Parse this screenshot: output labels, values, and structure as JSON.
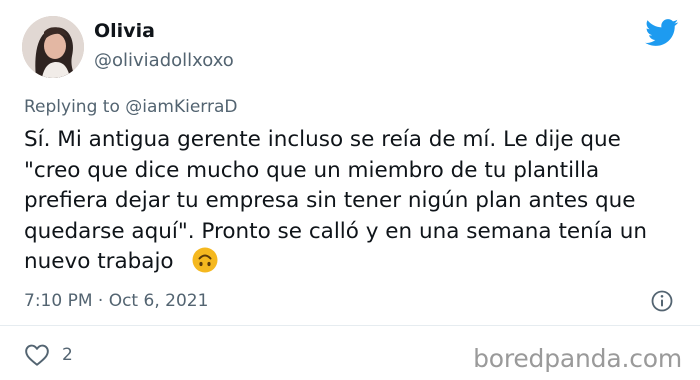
{
  "author": {
    "display_name": "Olivia",
    "handle": "@oliviadollxoxo"
  },
  "reply_context": "Replying to @iamKierraD",
  "tweet_text": "Sí. Mi antigua gerente incluso se reía de mí. Le dije que \"creo que dice mucho que un miembro de tu plantilla prefiera dejar tu empresa sin tener nigún plan antes que quedarse aquí\". Pronto se calló y en una semana tenía un nuevo trabajo",
  "emoji": "upside-down-face",
  "timestamp": "7:10 PM · Oct 6, 2021",
  "likes": "2",
  "watermark": "boredpanda.com",
  "icons": {
    "platform": "twitter-bird-icon",
    "info": "info-icon",
    "like": "heart-icon"
  },
  "colors": {
    "brand": "#1d9bf0",
    "secondary_text": "#536471",
    "primary_text": "#0f1419",
    "watermark": "#9a9a9a",
    "emoji_face": "#f5b81f"
  }
}
